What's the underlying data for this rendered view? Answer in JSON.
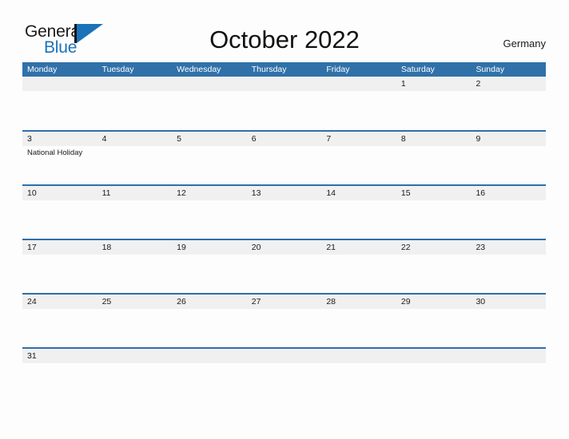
{
  "logo": {
    "word_dark": "General",
    "word_blue": "Blue",
    "mark": "triangle-flag-mark",
    "blue_hex": "#1b72b8"
  },
  "header": {
    "title": "October 2022",
    "country": "Germany"
  },
  "colors": {
    "header_blue": "#3071a9",
    "row_divider_blue": "#2f6fa8",
    "date_band_gray": "#f0f0f0",
    "page_background": "#fdfdfd",
    "text_dark": "#1a1a1a"
  },
  "calendar": {
    "month": "October",
    "year": "2022",
    "weekdays": [
      "Monday",
      "Tuesday",
      "Wednesday",
      "Thursday",
      "Friday",
      "Saturday",
      "Sunday"
    ],
    "weeks": [
      {
        "days": [
          {
            "num": "",
            "events": []
          },
          {
            "num": "",
            "events": []
          },
          {
            "num": "",
            "events": []
          },
          {
            "num": "",
            "events": []
          },
          {
            "num": "",
            "events": []
          },
          {
            "num": "1",
            "events": []
          },
          {
            "num": "2",
            "events": []
          }
        ]
      },
      {
        "days": [
          {
            "num": "3",
            "events": [
              "National Holiday"
            ]
          },
          {
            "num": "4",
            "events": []
          },
          {
            "num": "5",
            "events": []
          },
          {
            "num": "6",
            "events": []
          },
          {
            "num": "7",
            "events": []
          },
          {
            "num": "8",
            "events": []
          },
          {
            "num": "9",
            "events": []
          }
        ]
      },
      {
        "days": [
          {
            "num": "10",
            "events": []
          },
          {
            "num": "11",
            "events": []
          },
          {
            "num": "12",
            "events": []
          },
          {
            "num": "13",
            "events": []
          },
          {
            "num": "14",
            "events": []
          },
          {
            "num": "15",
            "events": []
          },
          {
            "num": "16",
            "events": []
          }
        ]
      },
      {
        "days": [
          {
            "num": "17",
            "events": []
          },
          {
            "num": "18",
            "events": []
          },
          {
            "num": "19",
            "events": []
          },
          {
            "num": "20",
            "events": []
          },
          {
            "num": "21",
            "events": []
          },
          {
            "num": "22",
            "events": []
          },
          {
            "num": "23",
            "events": []
          }
        ]
      },
      {
        "days": [
          {
            "num": "24",
            "events": []
          },
          {
            "num": "25",
            "events": []
          },
          {
            "num": "26",
            "events": []
          },
          {
            "num": "27",
            "events": []
          },
          {
            "num": "28",
            "events": []
          },
          {
            "num": "29",
            "events": []
          },
          {
            "num": "30",
            "events": []
          }
        ]
      },
      {
        "days": [
          {
            "num": "31",
            "events": []
          },
          {
            "num": "",
            "events": []
          },
          {
            "num": "",
            "events": []
          },
          {
            "num": "",
            "events": []
          },
          {
            "num": "",
            "events": []
          },
          {
            "num": "",
            "events": []
          },
          {
            "num": "",
            "events": []
          }
        ]
      }
    ]
  }
}
